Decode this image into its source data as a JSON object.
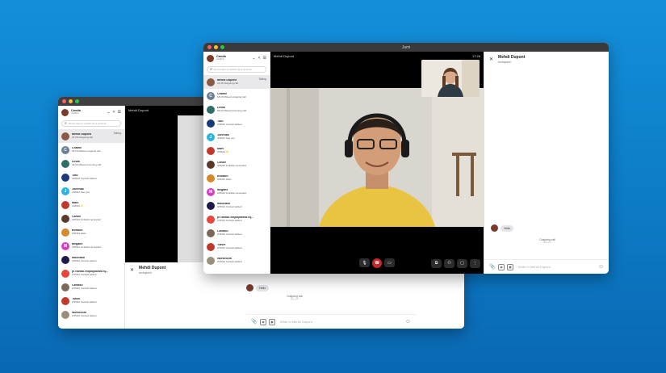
{
  "user": {
    "name": "Camila",
    "id": "cadilloc"
  },
  "search": {
    "placeholder": "Find a user or search for a convers..."
  },
  "contacts": [
    {
      "name": "Mehdi Dupont",
      "status": "21:45 Outgoing call",
      "badge": "Taking",
      "color": "#8a5a44"
    },
    {
      "name": "Charlie",
      "status": "18:23 Missed outgoing call",
      "color": "#6b8096",
      "initial": "C"
    },
    {
      "name": "Linda",
      "status": "09:32 Missed incoming call",
      "color": "#2f6f68"
    },
    {
      "name": "Tutu",
      "status": "4/18/22 Contact added",
      "color": "#1a3a7a"
    },
    {
      "name": "Johnnas",
      "status": "4/18/22 See you",
      "color": "#2bb2e0",
      "initial": "J"
    },
    {
      "name": "Marc",
      "status": "4/18/22 ⭐",
      "color": "#c0392b"
    },
    {
      "name": "Carole",
      "status": "3/25/22 Invitation accepted",
      "color": "#5a3b2b"
    },
    {
      "name": "Bonbon",
      "status": "3/25/22 Hello",
      "color": "#d4892a"
    },
    {
      "name": "Megane",
      "status": "3/25/22 Invitation accepted",
      "color": "#d63dc4",
      "initial": "M"
    },
    {
      "name": "Mountain",
      "status": "3/25/22 Contact added",
      "color": "#1e1b4a"
    },
    {
      "name": "jh7589867hkjkkjkkk9876j...",
      "status": "2/15/22 Contact added",
      "color": "#e8453c"
    },
    {
      "name": "Caribou",
      "status": "2/15/22 Contact added",
      "color": "#7a6a55"
    },
    {
      "name": "Travel",
      "status": "2/15/22 Contact added",
      "color": "#c0392b"
    },
    {
      "name": "Workroom",
      "status": "2/15/22 Contact added",
      "color": "#9a8f7a"
    }
  ],
  "call": {
    "peer_name": "Mehdi Dupont",
    "time": "17:28",
    "window_title": "Jami"
  },
  "chat": {
    "peer_name": "Mehdi Dupont",
    "peer_id": "mdupont",
    "message": "Hello",
    "call_note": "Outgoing call",
    "call_note_sub": "just now",
    "compose_placeholder": "Write to Mehdi Dupont"
  }
}
